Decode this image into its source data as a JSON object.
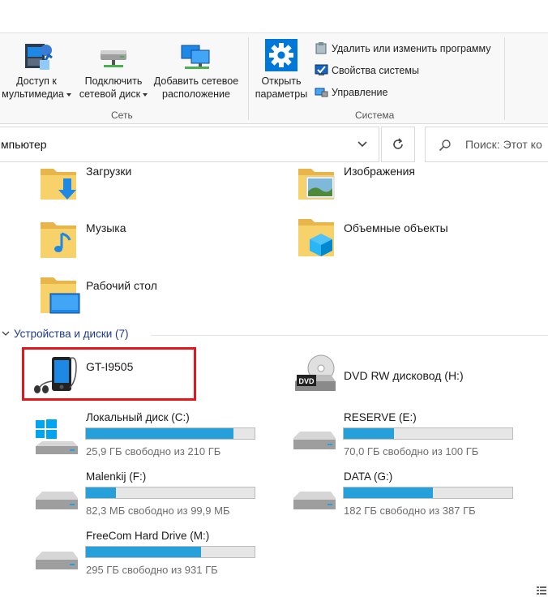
{
  "ribbon": {
    "network": {
      "label": "Сеть",
      "media_access": {
        "line1": "Доступ к",
        "line2": "мультимедиа"
      },
      "map_drive": {
        "line1": "Подключить",
        "line2": "сетевой диск"
      },
      "add_location": {
        "line1": "Добавить сетевое",
        "line2": "расположение"
      }
    },
    "system": {
      "label": "Система",
      "open_settings": {
        "line1": "Открыть",
        "line2": "параметры"
      },
      "uninstall": "Удалить или изменить программу",
      "properties": "Свойства системы",
      "manage": "Управление"
    }
  },
  "address": {
    "path": "мпьютер",
    "search_placeholder": "Поиск: Этот ко"
  },
  "folders": [
    {
      "name": "Загрузки"
    },
    {
      "name": "Изображения"
    },
    {
      "name": "Музыка"
    },
    {
      "name": "Объемные объекты"
    },
    {
      "name": "Рабочий стол"
    }
  ],
  "devices_section": {
    "title": "Устройства и диски (7)"
  },
  "devices": [
    {
      "name": "GT-I9505"
    },
    {
      "name": "DVD RW дисковод (H:)"
    }
  ],
  "drives": [
    {
      "name": "Локальный диск (C:)",
      "free_text": "25,9 ГБ свободно из 210 ГБ",
      "used_fraction": 0.877
    },
    {
      "name": "RESERVE (E:)",
      "free_text": "70,0 ГБ свободно из 100 ГБ",
      "used_fraction": 0.3
    },
    {
      "name": "Malenkij (F:)",
      "free_text": "82,3 МБ свободно из 99,9 МБ",
      "used_fraction": 0.176
    },
    {
      "name": "DATA (G:)",
      "free_text": "182 ГБ свободно из 387 ГБ",
      "used_fraction": 0.53
    },
    {
      "name": "FreeCom Hard Drive (M:)",
      "free_text": "295 ГБ свободно из 931 ГБ",
      "used_fraction": 0.683
    }
  ],
  "colors": {
    "accent": "#26a0da",
    "highlight": "#e4161b",
    "section": "#1e3a8a"
  }
}
